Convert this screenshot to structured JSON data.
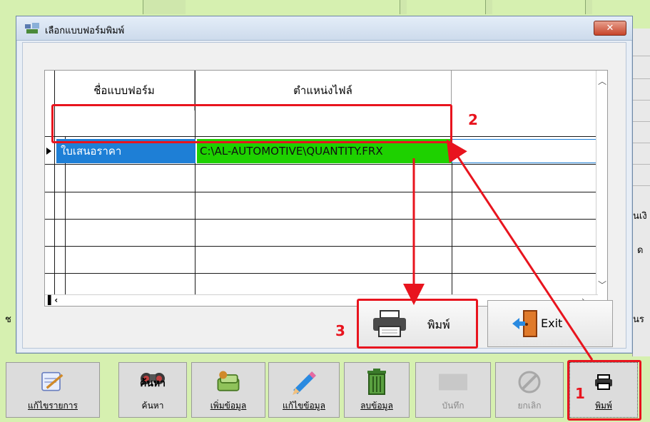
{
  "dialog": {
    "title": "เลือกแบบฟอร์มพิมพ์",
    "close_label": "✕"
  },
  "grid": {
    "columns": [
      "ชื่อแบบฟอร์ม",
      "ตำแหน่งไฟล์"
    ],
    "rows": [
      {
        "name": "ใบเสนอราคา",
        "path": "C:\\AL-AUTOMOTIVE\\QUANTITY.FRX"
      }
    ]
  },
  "buttons": {
    "print_label": "พิมพ์",
    "exit_label": "Exit"
  },
  "toolbar": {
    "edit_items_label": "แก้ไขรายการ",
    "search_label": "ค้นหา",
    "search_icon_label": "ค้นหา",
    "add_label": "เพิ่มข้อมูล",
    "edit_label": "แก้ไขข้อมูล",
    "delete_label": "ลบข้อมูล",
    "save_label": "บันทึก",
    "cancel_label": "ยกเลิก",
    "print_label": "พิมพ์"
  },
  "annotations": {
    "step1": "1",
    "step2": "2",
    "step3": "3"
  },
  "background": {
    "text_right_1": "นเงิ",
    "text_right_2": "ด",
    "text_right_3": "นร",
    "text_left": "ช"
  },
  "colors": {
    "annotation_red": "#e8141e",
    "selected_blue": "#1e7fd6",
    "path_green": "#1ed100",
    "app_green": "#d6f0b0"
  }
}
